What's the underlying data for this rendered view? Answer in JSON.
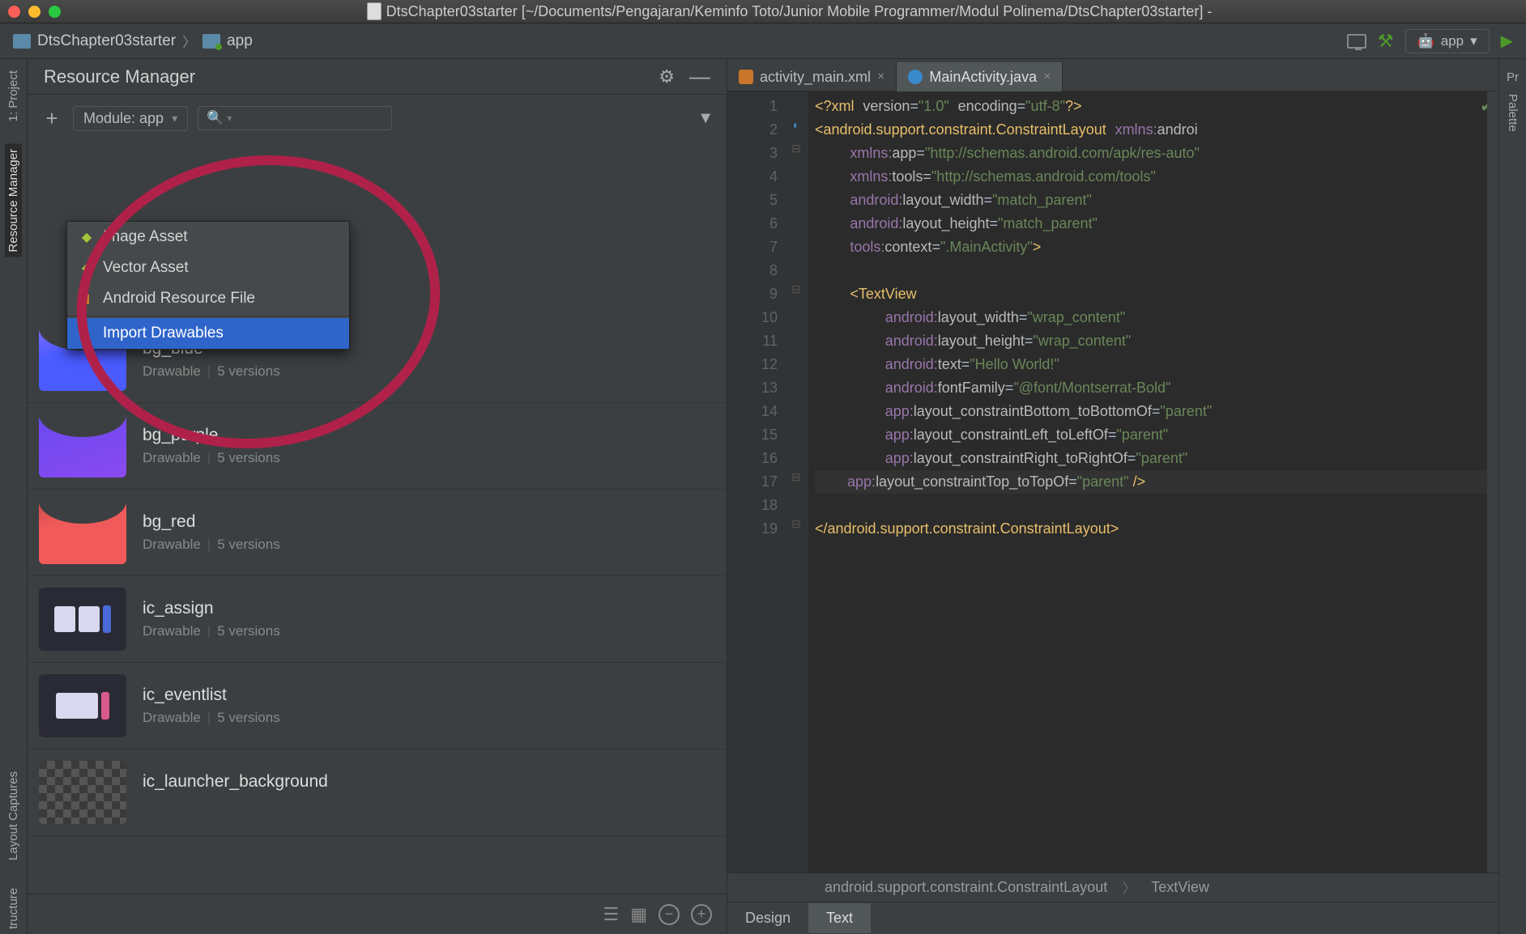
{
  "titlebar": {
    "title": "DtsChapter03starter [~/Documents/Pengajaran/Keminfo Toto/Junior Mobile Programmer/Modul Polinema/DtsChapter03starter] -"
  },
  "breadcrumb": {
    "project": "DtsChapter03starter",
    "module": "app",
    "run_config": "app"
  },
  "left_tabs": {
    "project": "1: Project",
    "resmgr": "Resource Manager",
    "captures": "Layout Captures",
    "structure": "tructure"
  },
  "right_tabs": {
    "palette": "Palette",
    "pr": "Pr"
  },
  "resmgr": {
    "title": "Resource Manager",
    "module_label": "Module: app",
    "search_placeholder": ""
  },
  "dropdown": {
    "items": [
      {
        "label": "Image Asset",
        "icon": "android"
      },
      {
        "label": "Vector Asset",
        "icon": "android"
      },
      {
        "label": "Android Resource File",
        "icon": "orange"
      }
    ],
    "selected": "Import Drawables"
  },
  "resources": [
    {
      "name": "bg_blue",
      "type": "Drawable",
      "versions": "5 versions",
      "thumb": "blue"
    },
    {
      "name": "bg_purple",
      "type": "Drawable",
      "versions": "5 versions",
      "thumb": "purple"
    },
    {
      "name": "bg_red",
      "type": "Drawable",
      "versions": "5 versions",
      "thumb": "red"
    },
    {
      "name": "ic_assign",
      "type": "Drawable",
      "versions": "5 versions",
      "thumb": "dark"
    },
    {
      "name": "ic_eventlist",
      "type": "Drawable",
      "versions": "5 versions",
      "thumb": "dark"
    },
    {
      "name": "ic_launcher_background",
      "type": "",
      "versions": "",
      "thumb": "checker"
    }
  ],
  "editor": {
    "tabs": [
      {
        "label": "activity_main.xml",
        "icon": "xml",
        "active": false
      },
      {
        "label": "MainActivity.java",
        "icon": "java",
        "active": true
      }
    ],
    "breadcrumb": [
      "android.support.constraint.ConstraintLayout",
      "TextView"
    ],
    "design_tabs": {
      "design": "Design",
      "text": "Text"
    },
    "lines": [
      "<?xml version=\"1.0\" encoding=\"utf-8\"?>",
      "<android.support.constraint.ConstraintLayout xmlns:androi",
      "    xmlns:app=\"http://schemas.android.com/apk/res-auto\"",
      "    xmlns:tools=\"http://schemas.android.com/tools\"",
      "    android:layout_width=\"match_parent\"",
      "    android:layout_height=\"match_parent\"",
      "    tools:context=\".MainActivity\">",
      "",
      "    <TextView",
      "        android:layout_width=\"wrap_content\"",
      "        android:layout_height=\"wrap_content\"",
      "        android:text=\"Hello World!\"",
      "        android:fontFamily=\"@font/Montserrat-Bold\"",
      "        app:layout_constraintBottom_toBottomOf=\"parent\"",
      "        app:layout_constraintLeft_toLeftOf=\"parent\"",
      "        app:layout_constraintRight_toRightOf=\"parent\"",
      "        app:layout_constraintTop_toTopOf=\"parent\" />",
      "",
      "</android.support.constraint.ConstraintLayout>"
    ]
  }
}
